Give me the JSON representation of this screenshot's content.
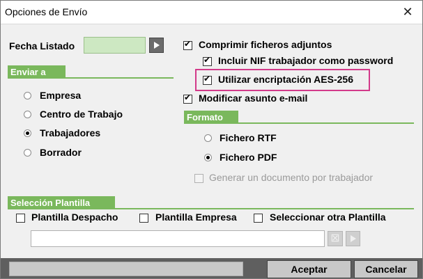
{
  "window": {
    "title": "Opciones de Envío",
    "close_glyph": "✕"
  },
  "fecha": {
    "label": "Fecha Listado",
    "value": ""
  },
  "enviar_a": {
    "header": "Enviar a",
    "options": [
      {
        "label": "Empresa",
        "selected": false
      },
      {
        "label": "Centro de Trabajo",
        "selected": false
      },
      {
        "label": "Trabajadores",
        "selected": true
      },
      {
        "label": "Borrador",
        "selected": false
      }
    ]
  },
  "options": {
    "comprimir": {
      "label": "Comprimir ficheros adjuntos",
      "checked": true
    },
    "incluir_nif": {
      "label": "Incluir NIF trabajador como password",
      "checked": true
    },
    "encriptacion": {
      "label": "Utilizar encriptación AES-256",
      "checked": true
    },
    "modificar_asunto": {
      "label": "Modificar asunto e-mail",
      "checked": true
    }
  },
  "formato": {
    "header": "Formato",
    "options": [
      {
        "label": "Fichero RTF",
        "selected": false
      },
      {
        "label": "Fichero PDF",
        "selected": true
      }
    ],
    "generar_doc": {
      "label": "Generar un documento por trabajador",
      "checked": false,
      "enabled": false
    }
  },
  "plantilla": {
    "header": "Selección Plantilla",
    "despacho": {
      "label": "Plantilla Despacho",
      "checked": false
    },
    "empresa": {
      "label": "Plantilla Empresa",
      "checked": false
    },
    "otra": {
      "label": "Seleccionar otra Plantilla",
      "checked": false
    },
    "path_value": ""
  },
  "buttons": {
    "accept": "Aceptar",
    "cancel": "Cancelar"
  },
  "colors": {
    "section_green": "#7ab85c",
    "highlight": "#d33a8a",
    "date_field": "#cde8c2"
  }
}
